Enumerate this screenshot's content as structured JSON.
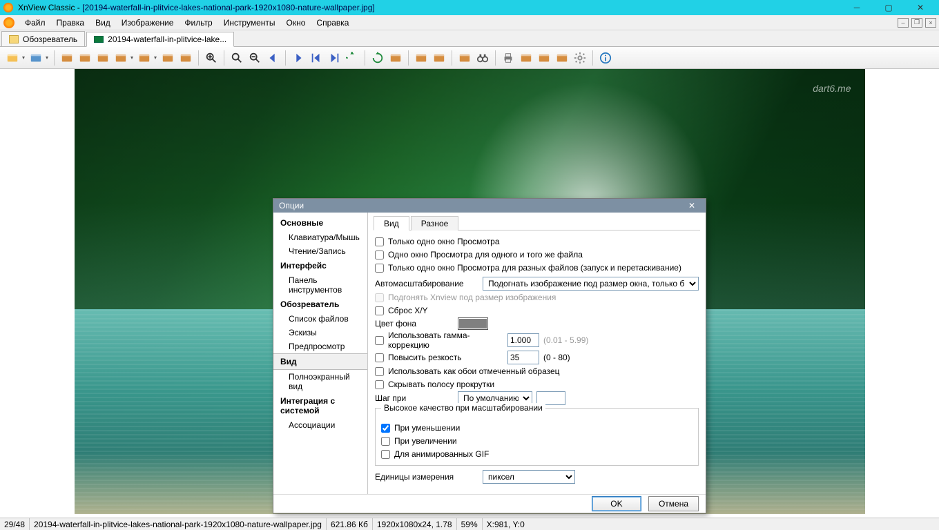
{
  "title_prefix": "XnView Classic - ",
  "title_file": "[20194-waterfall-in-plitvice-lakes-national-park-1920x1080-nature-wallpaper.jpg]",
  "menu": [
    "Файл",
    "Правка",
    "Вид",
    "Изображение",
    "Фильтр",
    "Инструменты",
    "Окно",
    "Справка"
  ],
  "tabs": [
    {
      "label": "Обозреватель",
      "active": false
    },
    {
      "label": "20194-waterfall-in-plitvice-lake...",
      "active": true
    }
  ],
  "toolbar_icons": [
    "folder-open",
    "save",
    "save-page",
    "convert",
    "scan",
    "slideshow",
    "capture-options",
    "compare",
    "hex",
    "zoom-in",
    "zoom-fit",
    "zoom-out",
    "prev",
    "next",
    "first",
    "last",
    "rotate-ccw",
    "rotate-cw",
    "fit-screen",
    "fit-window",
    "crop-selection",
    "select-all",
    "binoculars",
    "print",
    "set-wallpaper",
    "properties",
    "camera-capture",
    "settings",
    "info"
  ],
  "watermark": "dart6.me",
  "dialog": {
    "title": "Опции",
    "nav": [
      {
        "type": "cat",
        "label": "Основные"
      },
      {
        "type": "sub",
        "label": "Клавиатура/Мышь"
      },
      {
        "type": "sub",
        "label": "Чтение/Запись"
      },
      {
        "type": "cat",
        "label": "Интерфейс"
      },
      {
        "type": "sub",
        "label": "Панель инструментов"
      },
      {
        "type": "cat",
        "label": "Обозреватель"
      },
      {
        "type": "sub",
        "label": "Список файлов"
      },
      {
        "type": "sub",
        "label": "Эскизы"
      },
      {
        "type": "sub",
        "label": "Предпросмотр"
      },
      {
        "type": "cat",
        "label": "Вид",
        "active": true
      },
      {
        "type": "sub",
        "label": "Полноэкранный вид"
      },
      {
        "type": "cat",
        "label": "Интеграция с системой"
      },
      {
        "type": "sub",
        "label": "Ассоциации"
      }
    ],
    "inner_tabs": [
      "Вид",
      "Разное"
    ],
    "chk_only_one_view": "Только одно окно Просмотра",
    "chk_one_view_same": "Одно окно Просмотра для одного и того же файла",
    "chk_one_view_diff": "Только одно окно Просмотра для разных файлов (запуск и перетаскивание)",
    "lbl_autozoom": "Автомасштабирование",
    "sel_autozoom": "Подогнать изображение под размер окна, только б",
    "chk_fit_xn": "Подгонять Xnview под размер изображения",
    "chk_reset_xy": "Сброс X/Y",
    "lbl_bgcolor": "Цвет фона",
    "chk_gamma": "Использовать гамма-коррекцию",
    "val_gamma": "1.000",
    "hint_gamma": "(0.01 - 5.99)",
    "chk_sharpen": "Повысить резкость",
    "val_sharpen": "35",
    "hint_sharpen": "(0 - 80)",
    "chk_wallpaper_sample": "Использовать как обои отмеченный образец",
    "chk_hide_scroll": "Скрывать полосу прокрутки",
    "lbl_step": "Шаг при",
    "sel_step": "По умолчанию",
    "val_step": "",
    "fs_legend": "Высокое качество при масштабировании",
    "chk_hq_down": "При уменьшении",
    "chk_hq_up": "При увеличении",
    "chk_hq_gif": "Для анимированных GIF",
    "lbl_units": "Единицы измерения",
    "sel_units": "пиксел",
    "btn_ok": "OK",
    "btn_cancel": "Отмена"
  },
  "status": {
    "index": "29/48",
    "filename": "20194-waterfall-in-plitvice-lakes-national-park-1920x1080-nature-wallpaper.jpg",
    "filesize": "621.86 Кб",
    "dims": "1920x1080x24, 1.78",
    "zoom": "59%",
    "coords": "X:981, Y:0"
  }
}
